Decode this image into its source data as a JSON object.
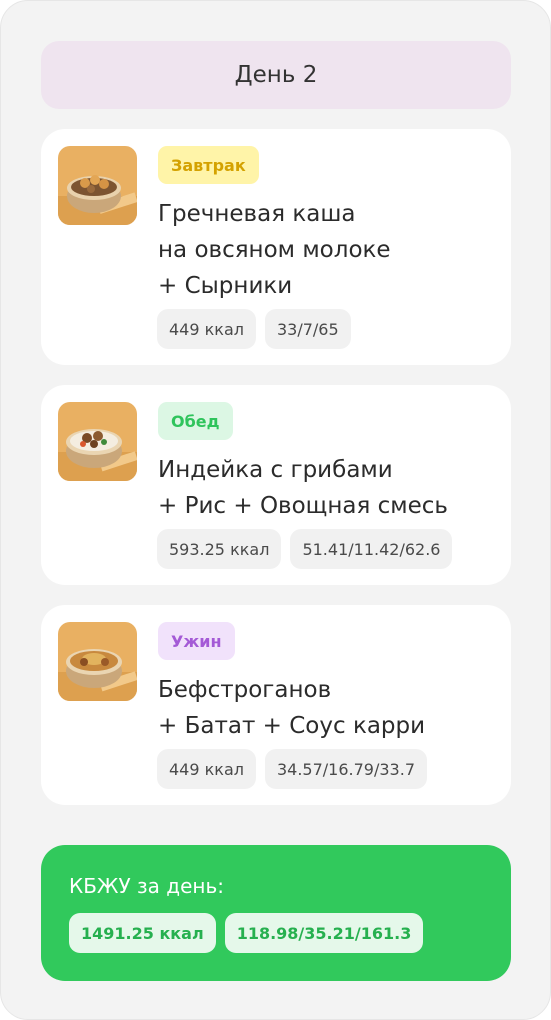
{
  "day": {
    "title": "День 2"
  },
  "meals": [
    {
      "type_label": "Завтрак",
      "title_lines": [
        "Гречневая каша",
        "на овсяном молоке",
        "+ Сырники"
      ],
      "calories": "449 ккал",
      "macros": "33/7/65"
    },
    {
      "type_label": "Обед",
      "title_lines": [
        "Индейка с грибами",
        "+ Рис + Овощная смесь"
      ],
      "calories": "593.25 ккал",
      "macros": "51.41/11.42/62.6"
    },
    {
      "type_label": "Ужин",
      "title_lines": [
        "Бефстроганов",
        "+ Батат + Соус карри"
      ],
      "calories": "449 ккал",
      "macros": "34.57/16.79/33.7"
    }
  ],
  "summary": {
    "title": "КБЖУ за день:",
    "calories": "1491.25 ккал",
    "macros": "118.98/35.21/161.3"
  },
  "colors": {
    "summary_bg": "#31c95c",
    "breakfast_badge": "#fff4a8",
    "lunch_badge": "#dcf7e4",
    "dinner_badge": "#f1e2fb"
  },
  "icons": {
    "breakfast_image": "buckwheat-porridge-syrniki-image",
    "lunch_image": "turkey-mushrooms-rice-image",
    "dinner_image": "beef-stroganoff-sweet-potato-image"
  }
}
